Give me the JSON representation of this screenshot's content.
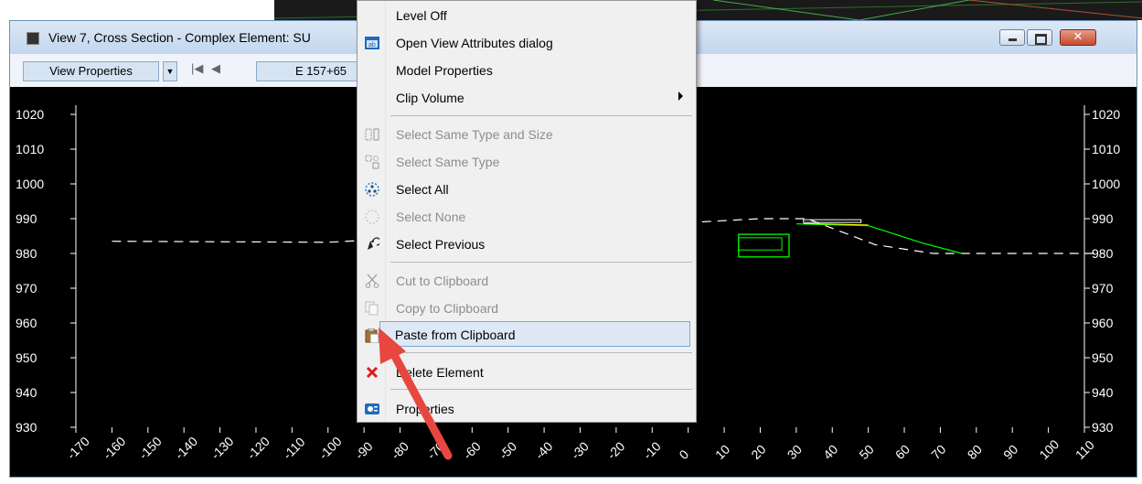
{
  "window": {
    "title": "View 7, Cross Section - Complex Element: SU"
  },
  "toolbar": {
    "view_properties_label": "View Properties",
    "station_value": "E 157+65"
  },
  "context_menu": {
    "items": [
      {
        "label": "Level Off",
        "enabled": true,
        "icon": ""
      },
      {
        "label": "Open View Attributes dialog",
        "enabled": true,
        "icon": "view-attributes-icon"
      },
      {
        "label": "Model Properties",
        "enabled": true,
        "icon": ""
      },
      {
        "label": "Clip Volume",
        "enabled": true,
        "icon": "",
        "submenu": true
      },
      {
        "label": "Select Same Type and Size",
        "enabled": false,
        "icon": "select-same-type-size-icon"
      },
      {
        "label": "Select Same Type",
        "enabled": false,
        "icon": "select-same-type-icon"
      },
      {
        "label": "Select All",
        "enabled": true,
        "icon": "select-all-icon"
      },
      {
        "label": "Select None",
        "enabled": false,
        "icon": "select-none-icon"
      },
      {
        "label": "Select Previous",
        "enabled": true,
        "icon": "select-previous-icon"
      },
      {
        "label": "Cut to Clipboard",
        "enabled": false,
        "icon": "scissors-icon"
      },
      {
        "label": "Copy to Clipboard",
        "enabled": false,
        "icon": "copy-icon"
      },
      {
        "label": "Paste from Clipboard",
        "enabled": true,
        "icon": "clipboard-paste-icon",
        "highlighted": true
      },
      {
        "label": "Delete Element",
        "enabled": true,
        "icon": "delete-x-icon"
      },
      {
        "label": "Properties",
        "enabled": true,
        "icon": "properties-icon"
      }
    ]
  },
  "chart_data": {
    "type": "line",
    "y_ticks_left": [
      "1020",
      "1010",
      "1000",
      "990",
      "980",
      "970",
      "960",
      "950",
      "940",
      "930"
    ],
    "y_ticks_right": [
      "1020",
      "1010",
      "1000",
      "990",
      "980",
      "970",
      "960",
      "950",
      "940",
      "930"
    ],
    "x_ticks": [
      "-170",
      "-160",
      "-150",
      "-140",
      "-130",
      "-120",
      "-110",
      "-100",
      "-90",
      "-80",
      "-70",
      "-60",
      "-50",
      "-40",
      "-30",
      "-20",
      "-10",
      "0",
      "10",
      "20",
      "30",
      "40",
      "50",
      "60",
      "70",
      "80",
      "90",
      "100",
      "110"
    ],
    "xlim": [
      -170,
      110
    ],
    "ylim": [
      930,
      1020
    ],
    "series": [
      {
        "style": "dashed",
        "color": "#ffffff",
        "points": [
          [
            -160,
            983.5
          ],
          [
            -100,
            983.2
          ],
          [
            20,
            990
          ],
          [
            33,
            990
          ],
          [
            52,
            982.5
          ],
          [
            68,
            980
          ],
          [
            115,
            980
          ]
        ]
      },
      {
        "style": "solid",
        "color": "#00ff00",
        "points": [
          [
            30,
            988.5
          ],
          [
            50,
            988
          ],
          [
            65,
            983
          ],
          [
            76,
            980
          ]
        ]
      }
    ],
    "colors": {
      "background": "#000000",
      "ground": "#ffffff",
      "design": "#00ff00",
      "highlight": "#ffff00"
    }
  },
  "colors": {
    "menu_highlight_bg": "#dfe9f5",
    "menu_highlight_border": "#7aa7d8",
    "annotation_arrow": "#e8473f"
  }
}
